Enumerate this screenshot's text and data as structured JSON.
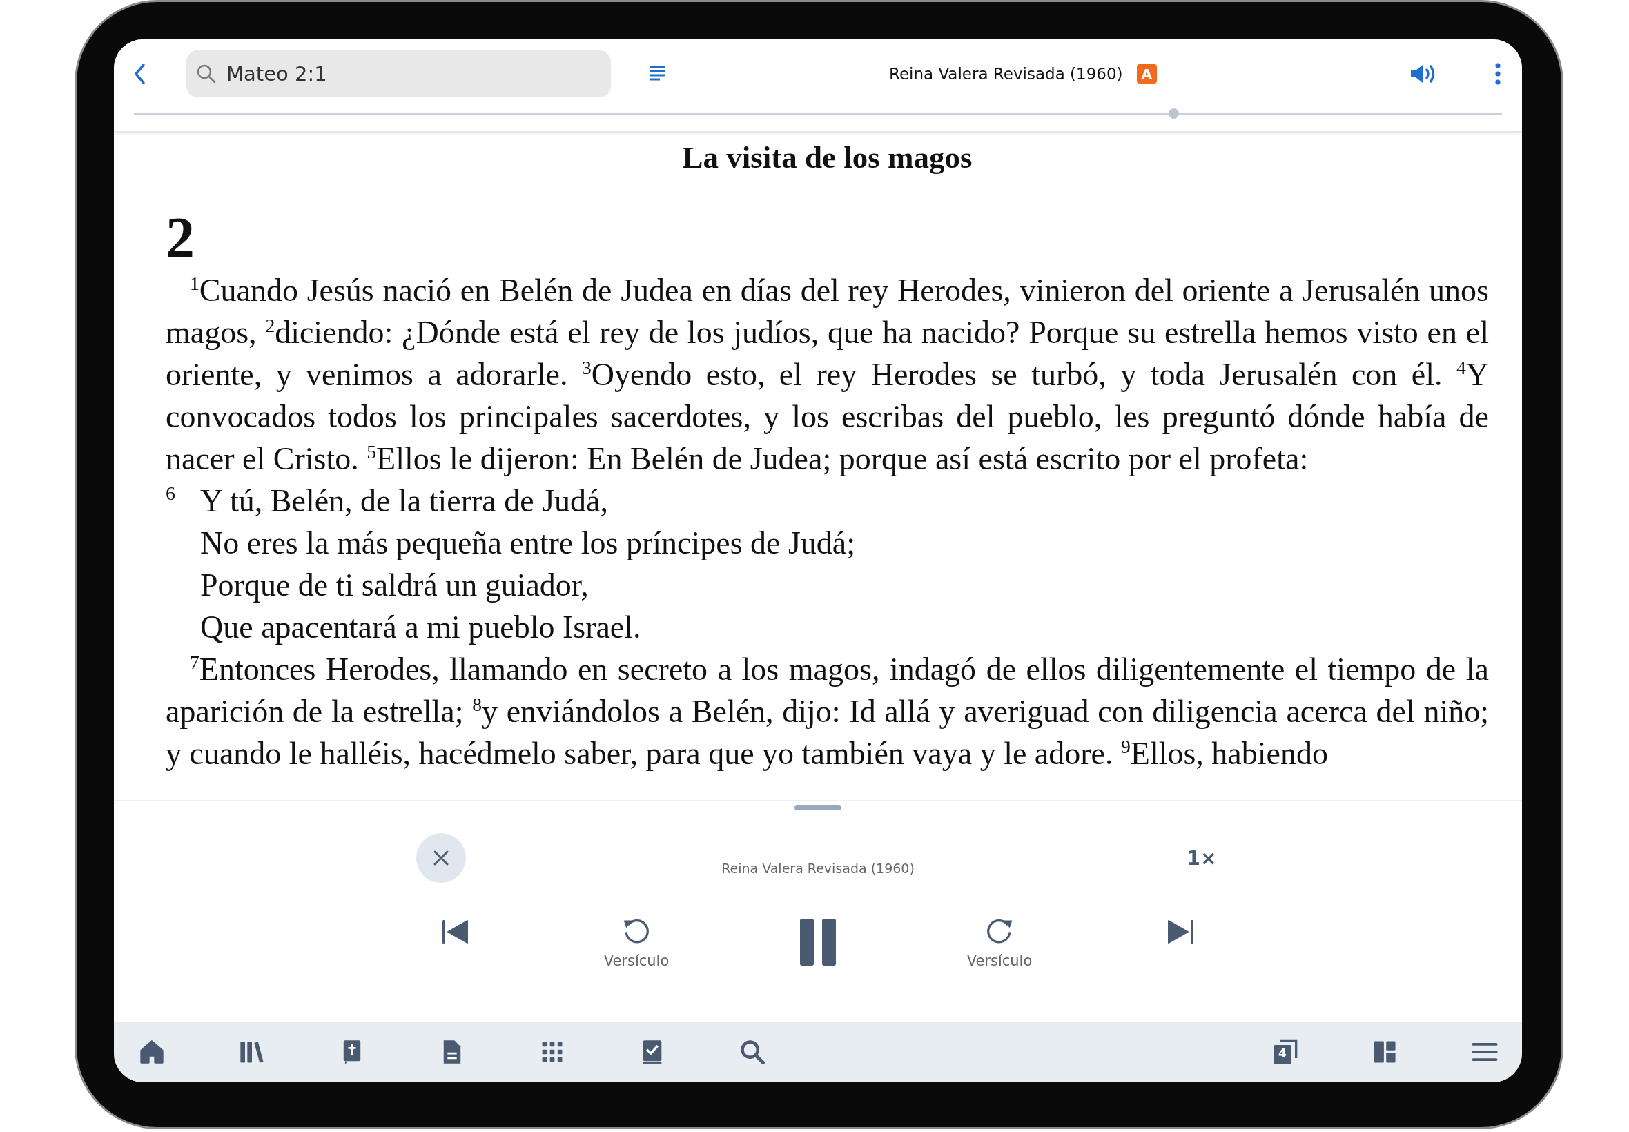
{
  "top_bar": {
    "search": {
      "value": "Mateo 2:1"
    },
    "version": "Reina Valera Revisada (1960)",
    "badge": "A",
    "progress": {
      "level": 0.76
    }
  },
  "reading": {
    "heading": "La visita de los magos",
    "chapter": "2",
    "blocks": [
      {
        "kind": "prose",
        "text": "$^{1}$Cuando Jesús nació en Belén de Judea en días del rey Herodes, vinieron del oriente a Jerusalén unos magos, $^{2}$diciendo: ¿Dónde está el rey de los judíos, que ha nacido? Porque su estrella hemos visto en el oriente, y venimos a adorarle. $^{3}$Oyendo esto, el rey Herodes se turbó, y toda Jerusalén con él. $^{4}$Y convocados todos los principales sacerdotes, y los escribas del pueblo, les preguntó dónde había de nacer el Cristo. $^{5}$Ellos le dijeron: En Belén de Judea; porque así está escrito por el profeta:"
      },
      {
        "kind": "poetry",
        "number": "6",
        "lines": [
          "Y tú, Belén, de la tierra de Judá,",
          "No eres la más pequeña entre los príncipes de Judá;",
          "Porque de ti saldrá un guiador,",
          "Que apacentará a mi pueblo Israel."
        ]
      },
      {
        "kind": "prose",
        "text": "$^{7}$Entonces Herodes, llamando en secreto a los magos, indagó de ellos diligentemente el tiempo de la aparición de la estrella; $^{8}$y enviándolos a Belén, dijo: Id allá y averiguad con diligencia acerca del niño; y cuando le halléis, hacédmelo saber, para que yo también vaya y le adore. $^{9}$Ellos, habiendo"
      }
    ]
  },
  "player": {
    "version": "Reina Valera Revisada (1960)",
    "speed": "1×",
    "back_label": "Versículo",
    "forward_label": "Versículo",
    "playing": true
  },
  "nav": [
    {
      "kind": "home"
    },
    {
      "kind": "library"
    },
    {
      "kind": "bible"
    },
    {
      "kind": "document"
    },
    {
      "kind": "grid"
    },
    {
      "kind": "checklist"
    },
    {
      "kind": "search"
    },
    {
      "kind": "spacer"
    },
    {
      "kind": "copies",
      "badge": "4"
    },
    {
      "kind": "layout"
    },
    {
      "kind": "menu"
    }
  ]
}
